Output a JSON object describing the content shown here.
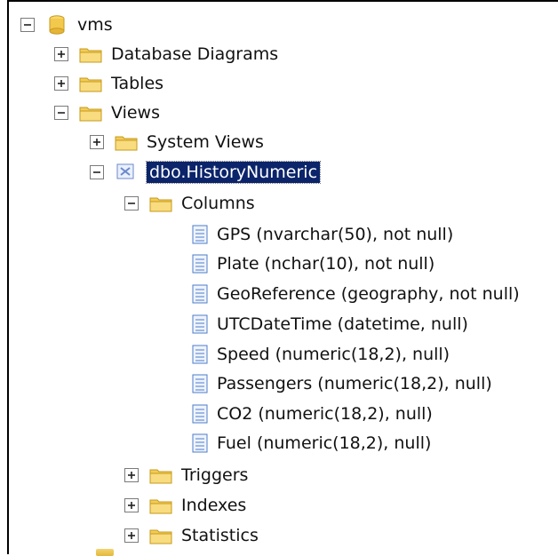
{
  "tree": {
    "database": {
      "label": "vms",
      "icon": "database-icon",
      "state": "expanded"
    },
    "database_diagrams": {
      "label": "Database Diagrams",
      "icon": "folder-icon",
      "state": "collapsed"
    },
    "tables": {
      "label": "Tables",
      "icon": "folder-icon",
      "state": "collapsed"
    },
    "views": {
      "label": "Views",
      "icon": "folder-icon",
      "state": "expanded"
    },
    "system_views": {
      "label": "System Views",
      "icon": "folder-icon",
      "state": "collapsed"
    },
    "selected_view": {
      "label": "dbo.HistoryNumeric",
      "icon": "view-icon",
      "state": "expanded",
      "selected": true
    },
    "columns_folder": {
      "label": "Columns",
      "icon": "folder-icon",
      "state": "expanded"
    },
    "columns": [
      {
        "label": "GPS (nvarchar(50), not null)",
        "icon": "column-icon"
      },
      {
        "label": "Plate (nchar(10), not null)",
        "icon": "column-icon"
      },
      {
        "label": "GeoReference (geography, not null)",
        "icon": "column-icon"
      },
      {
        "label": "UTCDateTime (datetime, null)",
        "icon": "column-icon"
      },
      {
        "label": "Speed (numeric(18,2), null)",
        "icon": "column-icon"
      },
      {
        "label": "Passengers (numeric(18,2), null)",
        "icon": "column-icon"
      },
      {
        "label": "CO2 (numeric(18,2), null)",
        "icon": "column-icon"
      },
      {
        "label": "Fuel (numeric(18,2), null)",
        "icon": "column-icon"
      }
    ],
    "triggers": {
      "label": "Triggers",
      "icon": "folder-icon",
      "state": "collapsed"
    },
    "indexes": {
      "label": "Indexes",
      "icon": "folder-icon",
      "state": "collapsed"
    },
    "statistics": {
      "label": "Statistics",
      "icon": "folder-icon",
      "state": "collapsed"
    }
  },
  "colors": {
    "selection_background": "#0b246a",
    "selection_text": "#ffffff",
    "folder_fill": "#f2cc58",
    "folder_edge": "#c79a1b",
    "column_icon_blue": "#4e7cc6"
  }
}
